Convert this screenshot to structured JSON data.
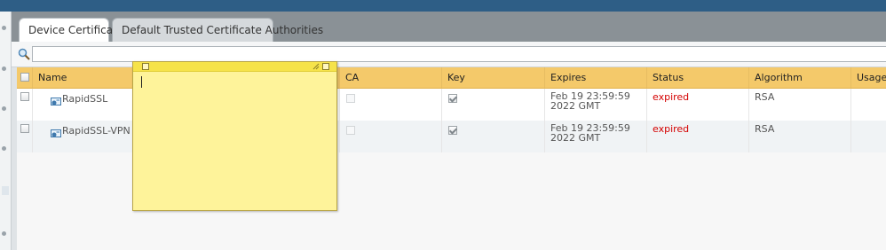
{
  "tabs": [
    {
      "label": "Device Certificates",
      "active": true
    },
    {
      "label": "Default Trusted Certificate Authorities",
      "active": false
    }
  ],
  "search": {
    "value": "",
    "placeholder": ""
  },
  "table": {
    "columns": [
      "Name",
      "CA",
      "Key",
      "Expires",
      "Status",
      "Algorithm",
      "Usage"
    ],
    "rows": [
      {
        "name": "RapidSSL",
        "ca": false,
        "key": true,
        "expires": "Feb 19 23:59:59 2022 GMT",
        "status": "expired",
        "algorithm": "RSA",
        "usage": ""
      },
      {
        "name": "RapidSSL-VPN",
        "ca": false,
        "key": true,
        "expires": "Feb 19 23:59:59 2022 GMT",
        "status": "expired",
        "algorithm": "RSA",
        "usage": ""
      }
    ]
  },
  "colors": {
    "header_bar": "#2e5e86",
    "table_header": "#f4c96a",
    "expired": "#d40000",
    "sticky_note": "#fef39a"
  },
  "icons": [
    "search-icon",
    "certificate-icon",
    "sticky-close-icon",
    "sticky-resize-icon"
  ]
}
